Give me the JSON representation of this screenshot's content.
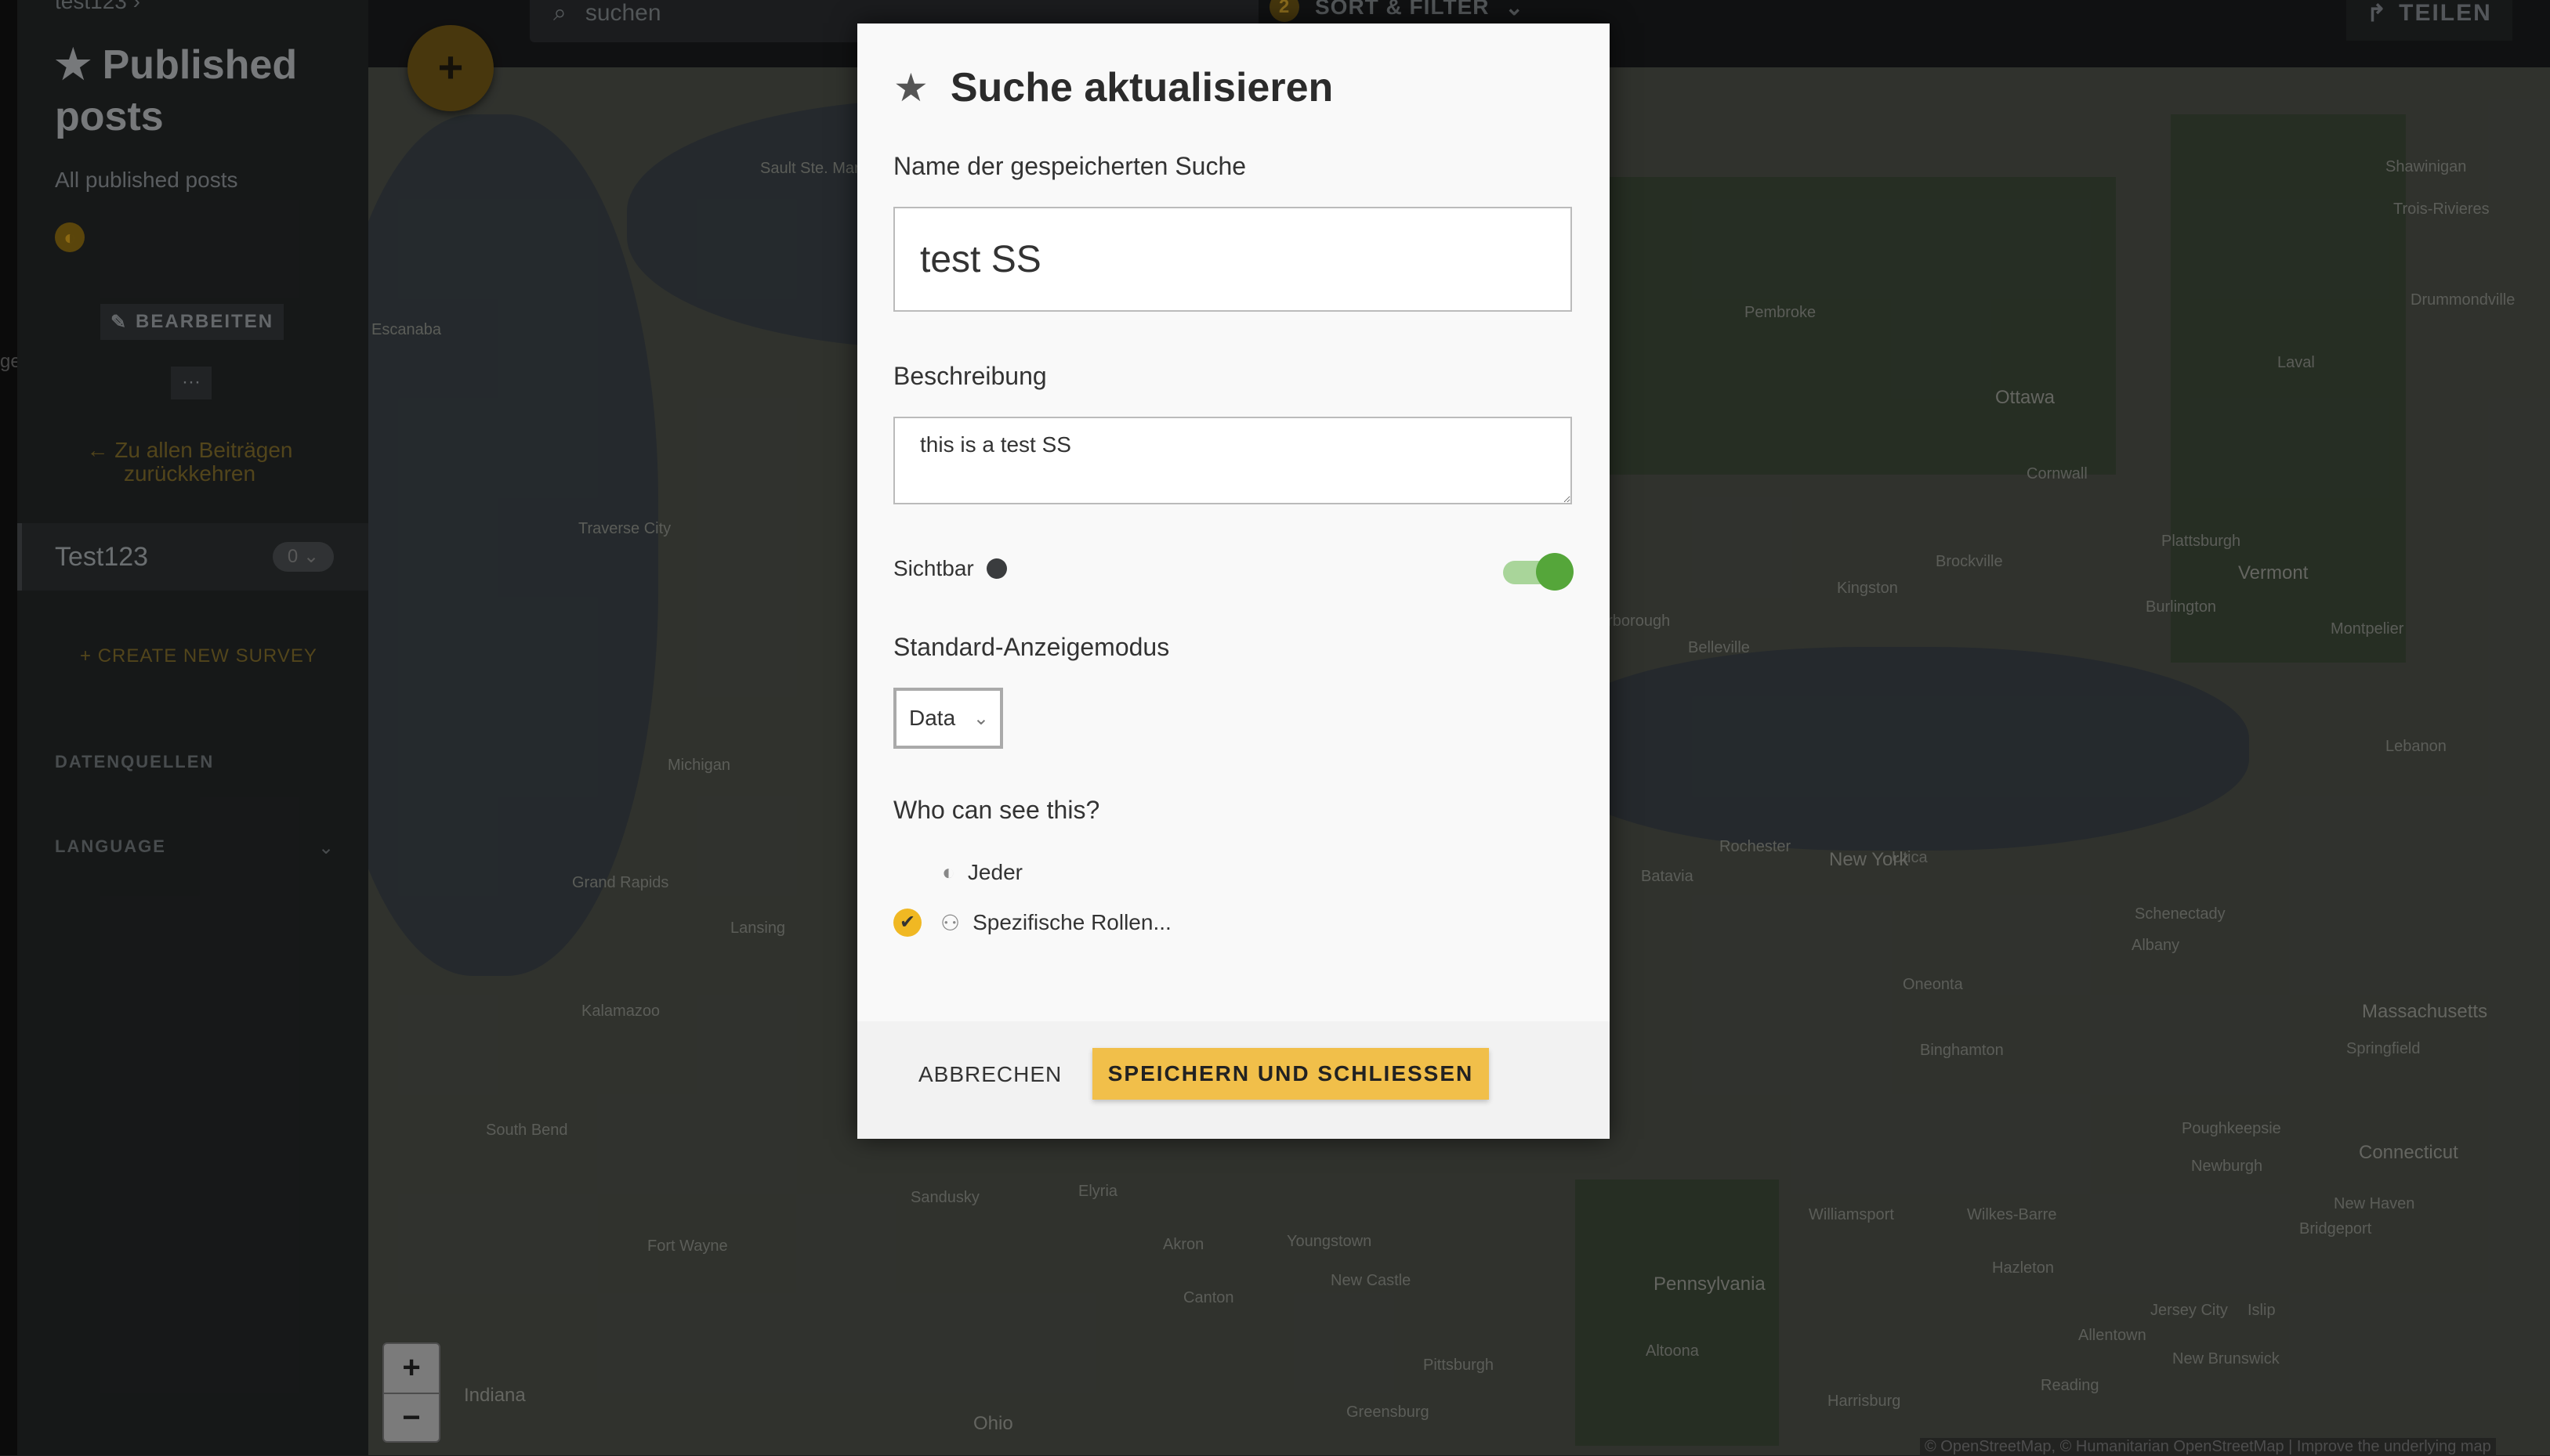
{
  "left_edge_fragment": "gen",
  "sidebar": {
    "breadcrumb": "test123",
    "title": "Published posts",
    "description": "All published posts",
    "edit_label": "BEARBEITEN",
    "more_label": "···",
    "back_label": "Zu allen Beiträgen zurückkehren",
    "survey": {
      "label": "Test123",
      "count": "0"
    },
    "create_survey_label": "CREATE NEW SURVEY",
    "data_sources_label": "DATENQUELLEN",
    "language_label": "LANGUAGE"
  },
  "topbar": {
    "search_placeholder": "suchen",
    "filter_count": "2",
    "sort_filter_label": "SORT & FILTER",
    "share_label": "TEILEN"
  },
  "map": {
    "attribution": "© OpenStreetMap, © Humanitarian OpenStreetMap | Improve the underlying map",
    "zoom_in": "+",
    "zoom_out": "−",
    "labels": [
      "Sault Ste. Marie",
      "Escanaba",
      "Traverse City",
      "Michigan",
      "Grand Rapids",
      "Lansing",
      "Kalamazoo",
      "South Bend",
      "Fort Wayne",
      "Sandusky",
      "Elyria",
      "Akron",
      "Youngstown",
      "New Castle",
      "Canton",
      "Pittsburgh",
      "Greensburg",
      "Indiana",
      "Ohio",
      "Pembroke",
      "Ottawa",
      "Cornwall",
      "Brockville",
      "Kingston",
      "Belleville",
      "Peterborough",
      "Rochester",
      "Batavia",
      "Utica",
      "Schenectady",
      "Albany",
      "Oneonta",
      "Binghamton",
      "Springfield",
      "Poughkeepsie",
      "Newburgh",
      "New Haven",
      "Bridgeport",
      "Williamsport",
      "Wilkes-Barre",
      "Hazleton",
      "Allentown",
      "Reading",
      "Harrisburg",
      "Altoona",
      "Jersey City",
      "New Brunswick",
      "Islip",
      "Plattsburgh",
      "Burlington",
      "Montpelier",
      "Lebanon",
      "Shawinigan",
      "Trois-Rivieres",
      "Drummondville",
      "Laval",
      "Vermont",
      "New York",
      "Massachusetts",
      "Connecticut",
      "Pennsylvania"
    ]
  },
  "modal": {
    "title": "Suche aktualisieren",
    "name_label": "Name der gespeicherten Suche",
    "name_value": "test SS",
    "description_label": "Beschreibung",
    "description_value": "this is a test SS",
    "visible_label": "Sichtbar",
    "visible_on": true,
    "display_mode_label": "Standard-Anzeigemodus",
    "display_mode_value": "Data",
    "who_label": "Who can see this?",
    "options": [
      {
        "label": "Jeder",
        "checked": false
      },
      {
        "label": "Spezifische Rollen...",
        "checked": true
      }
    ],
    "cancel_label": "ABBRECHEN",
    "save_label": "SPEICHERN UND SCHLIESSEN"
  },
  "colors": {
    "accent": "#f1bf4a",
    "toggle_on": "#55a63a"
  }
}
